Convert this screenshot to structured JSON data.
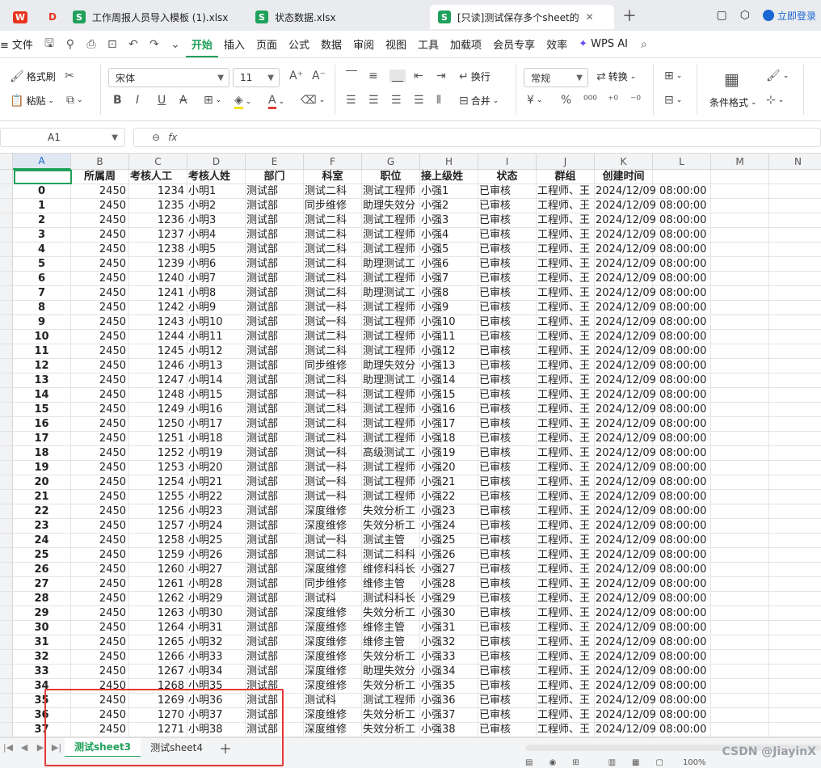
{
  "tabs": {
    "t1": "工作周报人员导入模板 (1).xlsx",
    "t2": "状态数据.xlsx",
    "t3": "[只读]测试保存多个sheet的"
  },
  "login": "立即登录",
  "menu": [
    "文件",
    "开始",
    "插入",
    "页面",
    "公式",
    "数据",
    "审阅",
    "视图",
    "工具",
    "加载项",
    "会员专享",
    "效率",
    "WPS AI"
  ],
  "ribbon": {
    "format_painter": "格式刷",
    "paste": "粘贴",
    "font": "宋体",
    "size": "11",
    "wrap": "换行",
    "number_format": "常规",
    "convert": "转换",
    "merge": "合并",
    "cond_format": "条件格式"
  },
  "namebox": "A1",
  "fx": "fx",
  "columns": [
    "A",
    "B",
    "C",
    "D",
    "E",
    "F",
    "G",
    "H",
    "I",
    "J",
    "K",
    "L",
    "M",
    "N"
  ],
  "headers": [
    "",
    "所属周",
    "考核人工",
    "考核人姓",
    "部门",
    "科室",
    "职位",
    "接上级姓",
    "状态",
    "群组",
    "创建时间"
  ],
  "rows": [
    [
      "0",
      "2450",
      "1234",
      "小明1",
      "测试部",
      "测试二科",
      "测试工程师",
      "小强1",
      "已审核",
      "工程师、王",
      "2024/12/09  08:00:00"
    ],
    [
      "1",
      "2450",
      "1235",
      "小明2",
      "测试部",
      "同步维修",
      "助理失效分",
      "小强2",
      "已审核",
      "工程师、王",
      "2024/12/09  08:00:00"
    ],
    [
      "2",
      "2450",
      "1236",
      "小明3",
      "测试部",
      "测试二科",
      "测试工程师",
      "小强3",
      "已审核",
      "工程师、王",
      "2024/12/09  08:00:00"
    ],
    [
      "3",
      "2450",
      "1237",
      "小明4",
      "测试部",
      "测试二科",
      "测试工程师",
      "小强4",
      "已审核",
      "工程师、王",
      "2024/12/09  08:00:00"
    ],
    [
      "4",
      "2450",
      "1238",
      "小明5",
      "测试部",
      "测试二科",
      "测试工程师",
      "小强5",
      "已审核",
      "工程师、王",
      "2024/12/09  08:00:00"
    ],
    [
      "5",
      "2450",
      "1239",
      "小明6",
      "测试部",
      "测试二科",
      "助理测试工",
      "小强6",
      "已审核",
      "工程师、王",
      "2024/12/09  08:00:00"
    ],
    [
      "6",
      "2450",
      "1240",
      "小明7",
      "测试部",
      "测试二科",
      "测试工程师",
      "小强7",
      "已审核",
      "工程师、王",
      "2024/12/09  08:00:00"
    ],
    [
      "7",
      "2450",
      "1241",
      "小明8",
      "测试部",
      "测试二科",
      "助理测试工",
      "小强8",
      "已审核",
      "工程师、王",
      "2024/12/09  08:00:00"
    ],
    [
      "8",
      "2450",
      "1242",
      "小明9",
      "测试部",
      "测试一科",
      "测试工程师",
      "小强9",
      "已审核",
      "工程师、王",
      "2024/12/09  08:00:00"
    ],
    [
      "9",
      "2450",
      "1243",
      "小明10",
      "测试部",
      "测试一科",
      "测试工程师",
      "小强10",
      "已审核",
      "工程师、王",
      "2024/12/09  08:00:00"
    ],
    [
      "10",
      "2450",
      "1244",
      "小明11",
      "测试部",
      "测试二科",
      "测试工程师",
      "小强11",
      "已审核",
      "工程师、王",
      "2024/12/09  08:00:00"
    ],
    [
      "11",
      "2450",
      "1245",
      "小明12",
      "测试部",
      "测试二科",
      "测试工程师",
      "小强12",
      "已审核",
      "工程师、王",
      "2024/12/09  08:00:00"
    ],
    [
      "12",
      "2450",
      "1246",
      "小明13",
      "测试部",
      "同步维修",
      "助理失效分",
      "小强13",
      "已审核",
      "工程师、王",
      "2024/12/09  08:00:00"
    ],
    [
      "13",
      "2450",
      "1247",
      "小明14",
      "测试部",
      "测试二科",
      "助理测试工",
      "小强14",
      "已审核",
      "工程师、王",
      "2024/12/09  08:00:00"
    ],
    [
      "14",
      "2450",
      "1248",
      "小明15",
      "测试部",
      "测试一科",
      "测试工程师",
      "小强15",
      "已审核",
      "工程师、王",
      "2024/12/09  08:00:00"
    ],
    [
      "15",
      "2450",
      "1249",
      "小明16",
      "测试部",
      "测试二科",
      "测试工程师",
      "小强16",
      "已审核",
      "工程师、王",
      "2024/12/09  08:00:00"
    ],
    [
      "16",
      "2450",
      "1250",
      "小明17",
      "测试部",
      "测试二科",
      "测试工程师",
      "小强17",
      "已审核",
      "工程师、王",
      "2024/12/09  08:00:00"
    ],
    [
      "17",
      "2450",
      "1251",
      "小明18",
      "测试部",
      "测试二科",
      "测试工程师",
      "小强18",
      "已审核",
      "工程师、王",
      "2024/12/09  08:00:00"
    ],
    [
      "18",
      "2450",
      "1252",
      "小明19",
      "测试部",
      "测试一科",
      "高级测试工",
      "小强19",
      "已审核",
      "工程师、王",
      "2024/12/09  08:00:00"
    ],
    [
      "19",
      "2450",
      "1253",
      "小明20",
      "测试部",
      "测试一科",
      "测试工程师",
      "小强20",
      "已审核",
      "工程师、王",
      "2024/12/09  08:00:00"
    ],
    [
      "20",
      "2450",
      "1254",
      "小明21",
      "测试部",
      "测试一科",
      "测试工程师",
      "小强21",
      "已审核",
      "工程师、王",
      "2024/12/09  08:00:00"
    ],
    [
      "21",
      "2450",
      "1255",
      "小明22",
      "测试部",
      "测试一科",
      "测试工程师",
      "小强22",
      "已审核",
      "工程师、王",
      "2024/12/09  08:00:00"
    ],
    [
      "22",
      "2450",
      "1256",
      "小明23",
      "测试部",
      "深度维修",
      "失效分析工",
      "小强23",
      "已审核",
      "工程师、王",
      "2024/12/09  08:00:00"
    ],
    [
      "23",
      "2450",
      "1257",
      "小明24",
      "测试部",
      "深度维修",
      "失效分析工",
      "小强24",
      "已审核",
      "工程师、王",
      "2024/12/09  08:00:00"
    ],
    [
      "24",
      "2450",
      "1258",
      "小明25",
      "测试部",
      "测试一科",
      "测试主管",
      "小强25",
      "已审核",
      "工程师、王",
      "2024/12/09  08:00:00"
    ],
    [
      "25",
      "2450",
      "1259",
      "小明26",
      "测试部",
      "测试二科",
      "测试二科科",
      "小强26",
      "已审核",
      "工程师、王",
      "2024/12/09  08:00:00"
    ],
    [
      "26",
      "2450",
      "1260",
      "小明27",
      "测试部",
      "深度维修",
      "维修科科长",
      "小强27",
      "已审核",
      "工程师、王",
      "2024/12/09  08:00:00"
    ],
    [
      "27",
      "2450",
      "1261",
      "小明28",
      "测试部",
      "同步维修",
      "维修主管",
      "小强28",
      "已审核",
      "工程师、王",
      "2024/12/09  08:00:00"
    ],
    [
      "28",
      "2450",
      "1262",
      "小明29",
      "测试部",
      "测试科",
      "测试科科长",
      "小强29",
      "已审核",
      "工程师、王",
      "2024/12/09  08:00:00"
    ],
    [
      "29",
      "2450",
      "1263",
      "小明30",
      "测试部",
      "深度维修",
      "失效分析工",
      "小强30",
      "已审核",
      "工程师、王",
      "2024/12/09  08:00:00"
    ],
    [
      "30",
      "2450",
      "1264",
      "小明31",
      "测试部",
      "深度维修",
      "维修主管",
      "小强31",
      "已审核",
      "工程师、王",
      "2024/12/09  08:00:00"
    ],
    [
      "31",
      "2450",
      "1265",
      "小明32",
      "测试部",
      "深度维修",
      "维修主管",
      "小强32",
      "已审核",
      "工程师、王",
      "2024/12/09  08:00:00"
    ],
    [
      "32",
      "2450",
      "1266",
      "小明33",
      "测试部",
      "深度维修",
      "失效分析工",
      "小强33",
      "已审核",
      "工程师、王",
      "2024/12/09  08:00:00"
    ],
    [
      "33",
      "2450",
      "1267",
      "小明34",
      "测试部",
      "深度维修",
      "助理失效分",
      "小强34",
      "已审核",
      "工程师、王",
      "2024/12/09  08:00:00"
    ],
    [
      "34",
      "2450",
      "1268",
      "小明35",
      "测试部",
      "深度维修",
      "失效分析工",
      "小强35",
      "已审核",
      "工程师、王",
      "2024/12/09  08:00:00"
    ],
    [
      "35",
      "2450",
      "1269",
      "小明36",
      "测试部",
      "测试科",
      "测试工程师",
      "小强36",
      "已审核",
      "工程师、王",
      "2024/12/09  08:00:00"
    ],
    [
      "36",
      "2450",
      "1270",
      "小明37",
      "测试部",
      "深度维修",
      "失效分析工",
      "小强37",
      "已审核",
      "工程师、王",
      "2024/12/09  08:00:00"
    ],
    [
      "37",
      "2450",
      "1271",
      "小明38",
      "测试部",
      "深度维修",
      "失效分析工",
      "小强38",
      "已审核",
      "工程师、王",
      "2024/12/09  08:00:00"
    ]
  ],
  "sheet_tabs": [
    "测试sheet3",
    "测试sheet4"
  ],
  "zoom": "100%",
  "watermark": "CSDN @JiayinX",
  "colors": {
    "accent": "#1fa15b",
    "highlight": "#e53935"
  }
}
